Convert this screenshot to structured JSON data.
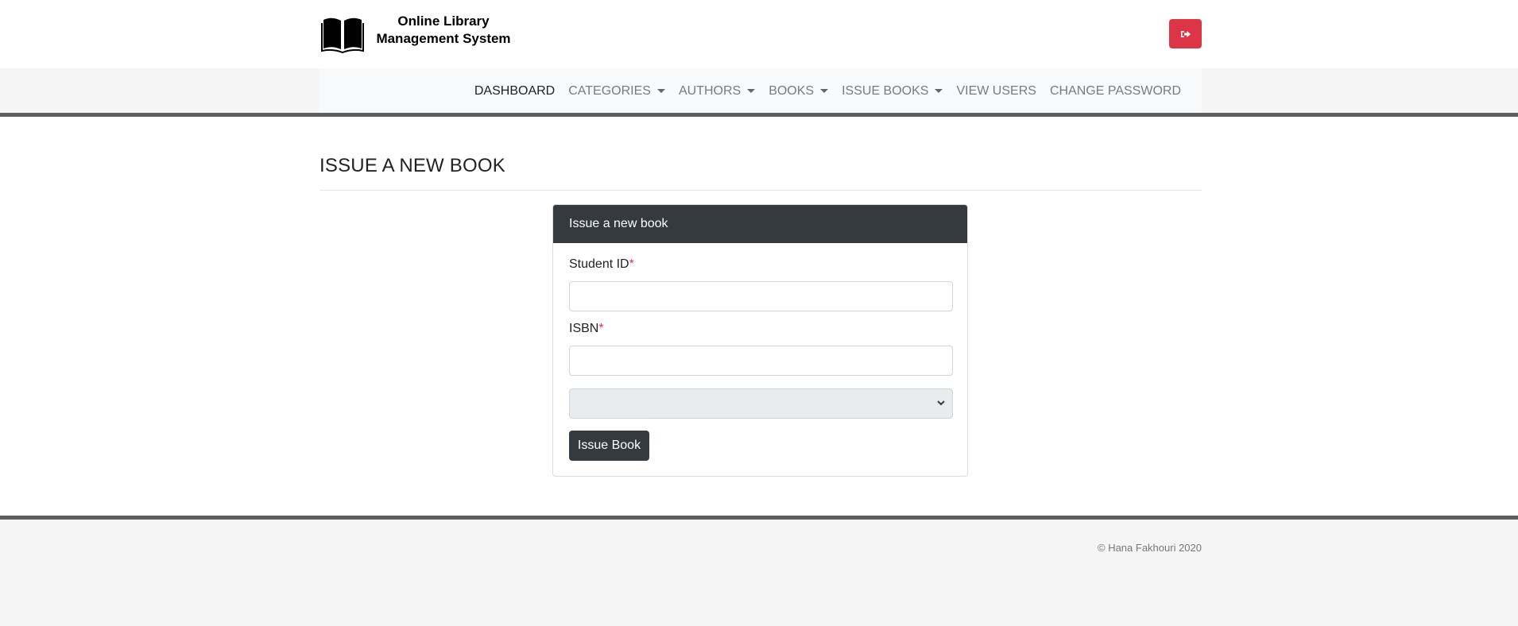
{
  "header": {
    "brand_line1": "Online Library",
    "brand_line2": "Management System",
    "logo_icon": "open-book-icon",
    "logout_icon": "sign-out-icon",
    "logout_color": "#dc3545"
  },
  "nav": {
    "items": [
      {
        "label": "DASHBOARD",
        "dropdown": false,
        "active": true
      },
      {
        "label": "CATEGORIES",
        "dropdown": true,
        "active": false
      },
      {
        "label": "AUTHORS",
        "dropdown": true,
        "active": false
      },
      {
        "label": "BOOKS",
        "dropdown": true,
        "active": false
      },
      {
        "label": "ISSUE BOOKS",
        "dropdown": true,
        "active": false
      },
      {
        "label": "VIEW USERS",
        "dropdown": false,
        "active": false
      },
      {
        "label": "CHANGE PASSWORD",
        "dropdown": false,
        "active": false
      }
    ]
  },
  "page": {
    "title": "ISSUE A NEW BOOK"
  },
  "form": {
    "header": "Issue a new book",
    "student_id_label": "Student ID",
    "student_id_value": "",
    "isbn_label": "ISBN",
    "isbn_value": "",
    "required_mark": "*",
    "select_value": "",
    "submit_label": "Issue Book"
  },
  "footer": {
    "copyright": "© Hana Fakhouri 2020"
  },
  "colors": {
    "dark": "#343a40",
    "danger": "#dc3545",
    "rule": "#5f5f5f"
  }
}
